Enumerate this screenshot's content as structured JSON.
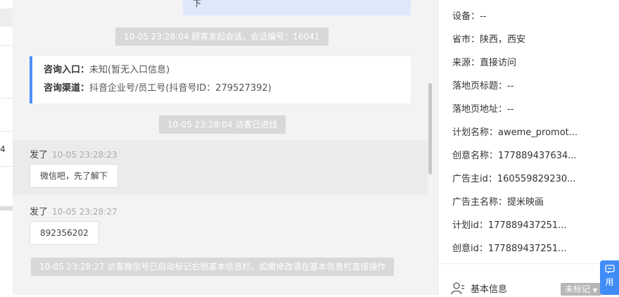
{
  "chat": {
    "top_message_fragment": "下",
    "system_1": "10-05 23:28:04 顾客发起会话，会话编号：16041",
    "consult": {
      "entry_label": "咨询入口：",
      "entry_value": "未知(暂无入口信息)",
      "channel_label": "咨询渠道：",
      "channel_value": "抖音企业号/员工号(抖音号ID：279527392)"
    },
    "system_2": "10-05 23:28:04 访客已进线",
    "messages": [
      {
        "sender": "发了",
        "time": "10-05 23:28:23",
        "text": "微信吧，先了解下"
      },
      {
        "sender": "发了",
        "time": "10-05 23:28:27",
        "text": "892356202"
      }
    ],
    "system_3": "10-05 23:28:27 访客微信号已自动标记右侧基本信息栏，如需修改请在基本信息栏直接操作"
  },
  "left_strip": {
    "fragment": "4"
  },
  "info_panel": {
    "items": [
      {
        "label": "设备：",
        "value": "--"
      },
      {
        "label": "省市：",
        "value": "陕西，西安"
      },
      {
        "label": "来源：",
        "value": "直接访问"
      },
      {
        "label": "落地页标题：",
        "value": "--"
      },
      {
        "label": "落地页地址：",
        "value": "--"
      },
      {
        "label": "计划名称：",
        "value": "aweme_promot..."
      },
      {
        "label": "创意名称：",
        "value": "177889437634..."
      },
      {
        "label": "广告主id：",
        "value": "160559829230..."
      },
      {
        "label": "广告主名称：",
        "value": "提米映画"
      },
      {
        "label": "计划id：",
        "value": "177889437251..."
      },
      {
        "label": "创意id：",
        "value": "177889437251..."
      }
    ],
    "section_title": "基本信息",
    "tag": "未标记",
    "float_button": "用"
  },
  "colors": {
    "accent": "#4a8ff7",
    "float_button": "#3f8cf6",
    "system_bg": "#d8d8d8",
    "bubble_blue": "#dde8fb"
  }
}
